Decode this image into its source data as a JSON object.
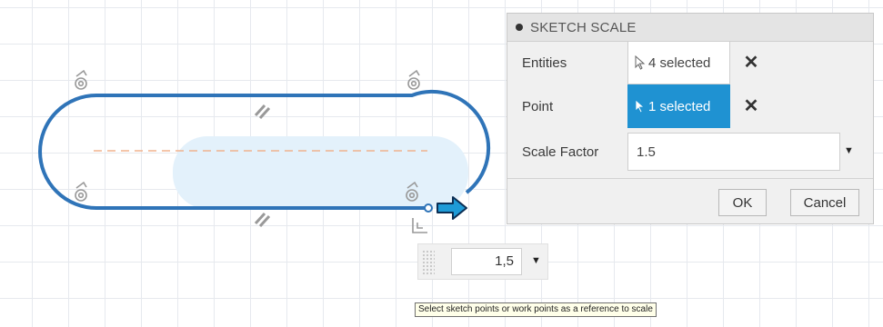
{
  "dialog": {
    "title": "SKETCH SCALE",
    "entities": {
      "label": "Entities",
      "value": "4 selected",
      "clear_icon": "close-icon"
    },
    "point": {
      "label": "Point",
      "value": "1 selected",
      "clear_icon": "close-icon"
    },
    "scale_factor": {
      "label": "Scale Factor",
      "value": "1.5"
    },
    "ok_label": "OK",
    "cancel_label": "Cancel"
  },
  "inline_input": {
    "value": "1,5"
  },
  "tooltip": "Select sketch points or work points as a reference to scale",
  "colors": {
    "sketch_line": "#2f74b8",
    "centerline": "#f0b38e",
    "selection_fill": "#e3f1fb",
    "accent": "#1f92d2",
    "arrow_fill": "#1e9bd7",
    "grid": "#e6e9ee"
  },
  "icons": [
    "horizontal-vertical-constraint-icon",
    "parallel-constraint-icon",
    "fix-constraint-icon",
    "direction-arrow-icon",
    "cursor-icon"
  ]
}
